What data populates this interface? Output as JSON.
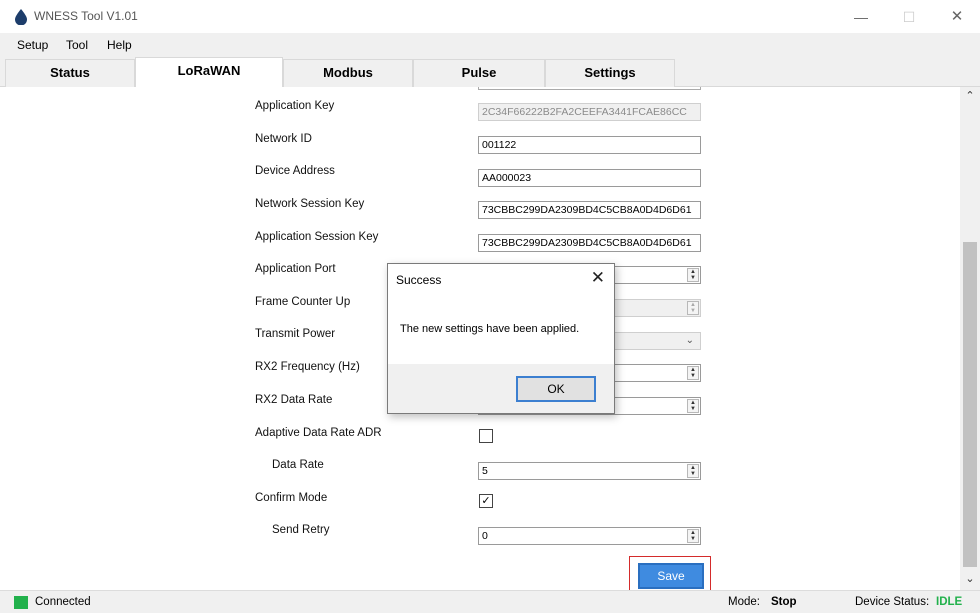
{
  "window": {
    "title": "WNESS Tool V1.01",
    "minimize": "—",
    "maximize": "☐",
    "close": "✕"
  },
  "menu": [
    "Setup",
    "Tool",
    "Help"
  ],
  "tabs": [
    "Status",
    "LoRaWAN",
    "Modbus",
    "Pulse",
    "Settings"
  ],
  "active_tab": "LoRaWAN",
  "form": {
    "application_key": {
      "label": "Application Key",
      "value": "2C34F66222B2FA2CEEFA3441FCAE86CC",
      "disabled": true
    },
    "network_id": {
      "label": "Network ID",
      "value": "001122"
    },
    "device_address": {
      "label": "Device Address",
      "value": "AA000023"
    },
    "network_session_key": {
      "label": "Network Session Key",
      "value": "73CBBC299DA2309BD4C5CB8A0D4D6D61"
    },
    "application_session_key": {
      "label": "Application Session Key",
      "value": "73CBBC299DA2309BD4C5CB8A0D4D6D61"
    },
    "application_port": {
      "label": "Application Port",
      "value": ""
    },
    "frame_counter_up": {
      "label": "Frame Counter Up",
      "value": "",
      "disabled": true
    },
    "transmit_power": {
      "label": "Transmit Power",
      "value": "",
      "disabled": true
    },
    "rx2_frequency": {
      "label": "RX2 Frequency (Hz)",
      "value": ""
    },
    "rx2_data_rate": {
      "label": "RX2 Data Rate",
      "value": ""
    },
    "adaptive_data_rate": {
      "label": "Adaptive Data Rate ADR",
      "checked": false
    },
    "data_rate": {
      "label": "Data Rate",
      "value": "5"
    },
    "confirm_mode": {
      "label": "Confirm Mode",
      "checked": true
    },
    "send_retry": {
      "label": "Send Retry",
      "value": "0"
    }
  },
  "save_label": "Save",
  "status": {
    "connection": "Connected",
    "mode_label": "Mode:",
    "mode_value": "Stop",
    "device_status_label": "Device Status:",
    "device_status_value": "IDLE",
    "connected_color": "#22b14c"
  },
  "dialog": {
    "title": "Success",
    "message": "The new settings have been applied.",
    "ok_label": "OK"
  }
}
